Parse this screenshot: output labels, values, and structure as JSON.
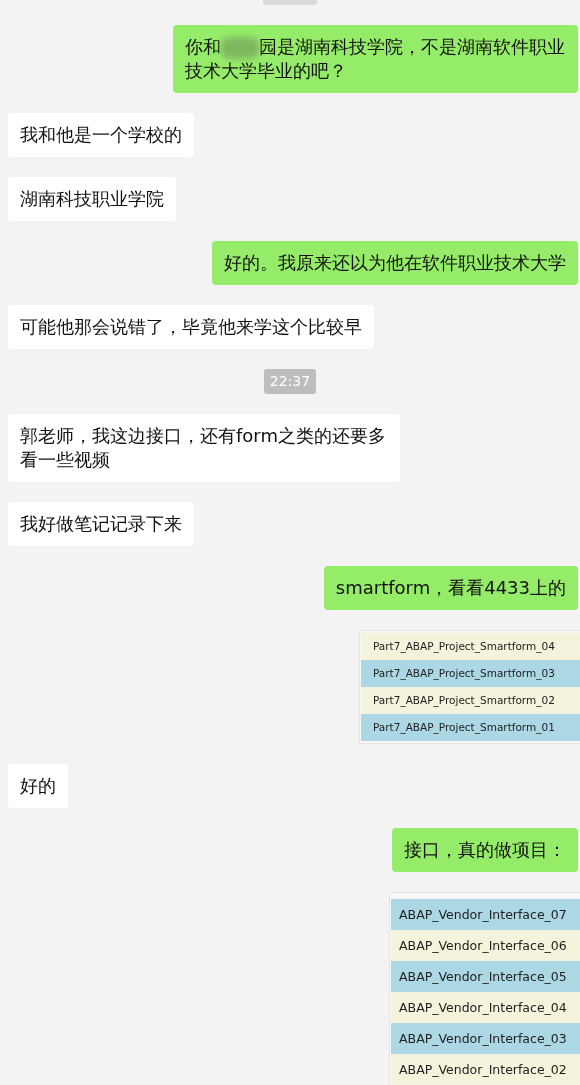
{
  "messages": [
    {
      "kind": "time_cut"
    },
    {
      "kind": "text",
      "outgoing": true,
      "redacted": true,
      "text_before": "你和",
      "text": "园是湖南科技学院，不是湖南软件职业技术大学毕业的吧？"
    },
    {
      "kind": "text",
      "outgoing": false,
      "text": "我和他是一个学校的"
    },
    {
      "kind": "text",
      "outgoing": false,
      "text": "湖南科技职业学院"
    },
    {
      "kind": "text",
      "outgoing": true,
      "text": "好的。我原来还以为他在软件职业技术大学"
    },
    {
      "kind": "text",
      "outgoing": false,
      "text": "可能他那会说错了，毕竟他来学这个比较早"
    },
    {
      "kind": "time",
      "text": "22:37"
    },
    {
      "kind": "text",
      "outgoing": false,
      "text": "郭老师，我这边接口，还有form之类的还要多看一些视频"
    },
    {
      "kind": "text",
      "outgoing": false,
      "text": "我好做笔记记录下来"
    },
    {
      "kind": "text",
      "outgoing": true,
      "text": "smartform，看看4433上的"
    },
    {
      "kind": "image",
      "outgoing": true,
      "compact": true,
      "rows": [
        {
          "label": "Part7_ABAP_Project_Smartform_04",
          "color": "#f5f3dc"
        },
        {
          "label": "Part7_ABAP_Project_Smartform_03",
          "color": "#acd8e6"
        },
        {
          "label": "Part7_ABAP_Project_Smartform_02",
          "color": "#f5f3dc"
        },
        {
          "label": "Part7_ABAP_Project_Smartform_01",
          "color": "#acd8e6"
        }
      ]
    },
    {
      "kind": "text",
      "outgoing": false,
      "text": "好的"
    },
    {
      "kind": "text",
      "outgoing": true,
      "text": "接口，真的做项目："
    },
    {
      "kind": "image",
      "outgoing": true,
      "compact": false,
      "rows": [
        {
          "label": "ABAP_Vendor_Interface_07",
          "color": "#acd8e6"
        },
        {
          "label": "ABAP_Vendor_Interface_06",
          "color": "#f5f3dc"
        },
        {
          "label": "ABAP_Vendor_Interface_05",
          "color": "#acd8e6"
        },
        {
          "label": "ABAP_Vendor_Interface_04",
          "color": "#f5f3dc"
        },
        {
          "label": "ABAP_Vendor_Interface_03",
          "color": "#acd8e6"
        },
        {
          "label": "ABAP_Vendor_Interface_02",
          "color": "#f5f3dc"
        }
      ]
    }
  ]
}
